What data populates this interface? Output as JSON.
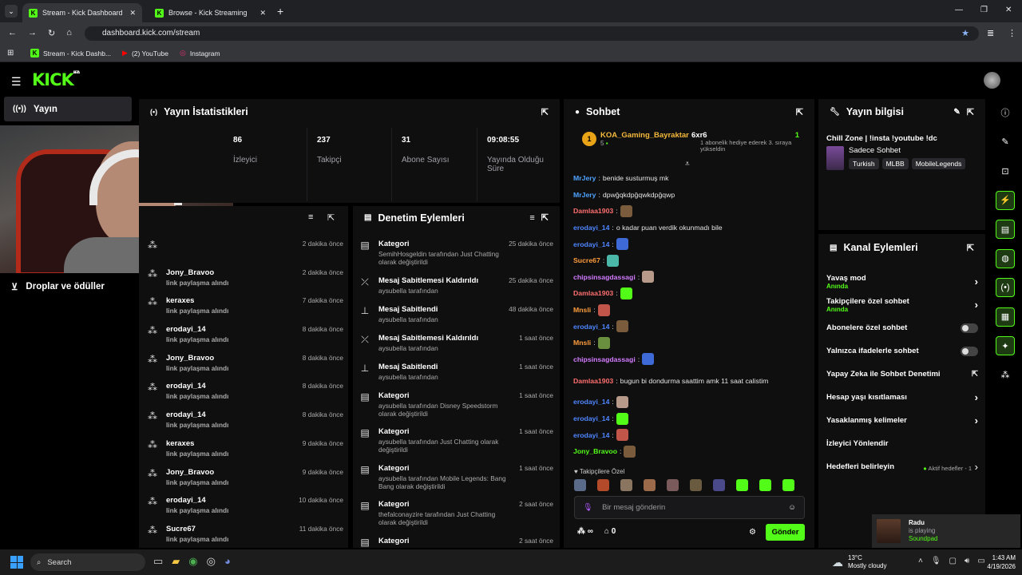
{
  "browser": {
    "tabs": [
      "Stream - Kick Dashboard",
      "Browse - Kick Streaming"
    ],
    "url": "dashboard.kick.com/stream",
    "bookmarks": [
      "Stream - Kick Dashb...",
      "(2) YouTube",
      "Instagram"
    ]
  },
  "app": {
    "logo": "KICK",
    "beta": "BETA"
  },
  "nav": {
    "stream": "Yayın",
    "drops": "Droplar ve ödüller"
  },
  "stats": {
    "title": "Yayın İstatistikleri",
    "items": [
      {
        "value": "86",
        "label": "İzleyici"
      },
      {
        "value": "237",
        "label": "Takipçi"
      },
      {
        "value": "31",
        "label": "Abone Sayısı"
      },
      {
        "value": "09:08:55",
        "label": "Yayında Olduğu Süre"
      }
    ]
  },
  "rewards": [
    {
      "user": "",
      "action": "",
      "time": "2 dakika önce"
    },
    {
      "user": "Jony_Bravoo",
      "action": "link paylaşma alındı",
      "time": "2 dakika önce"
    },
    {
      "user": "keraxes",
      "action": "link paylaşma alındı",
      "time": "7 dakika önce"
    },
    {
      "user": "erodayi_14",
      "action": "link paylaşma alındı",
      "time": "8 dakika önce"
    },
    {
      "user": "Jony_Bravoo",
      "action": "link paylaşma alındı",
      "time": "8 dakika önce"
    },
    {
      "user": "erodayi_14",
      "action": "link paylaşma alındı",
      "time": "8 dakika önce"
    },
    {
      "user": "erodayi_14",
      "action": "link paylaşma alındı",
      "time": "8 dakika önce"
    },
    {
      "user": "keraxes",
      "action": "link paylaşma alındı",
      "time": "9 dakika önce"
    },
    {
      "user": "Jony_Bravoo",
      "action": "link paylaşma alındı",
      "time": "9 dakika önce"
    },
    {
      "user": "erodayi_14",
      "action": "link paylaşma alındı",
      "time": "10 dakika önce"
    },
    {
      "user": "Sucre67",
      "action": "link paylaşma alındı",
      "time": "11 dakika önce"
    }
  ],
  "moderation": {
    "title": "Denetim Eylemleri",
    "items": [
      {
        "title": "Kategori",
        "sub": "SemihHosgeldin tarafından Just Chatting olarak değiştirildi",
        "time": "25 dakika önce",
        "icon": "category"
      },
      {
        "title": "Mesaj Sabitlemesi Kaldırıldı",
        "sub": "aysubella tarafından",
        "time": "25 dakika önce",
        "icon": "unpin"
      },
      {
        "title": "Mesaj Sabitlendi",
        "sub": "aysubella tarafından",
        "time": "48 dakika önce",
        "icon": "pin"
      },
      {
        "title": "Mesaj Sabitlemesi Kaldırıldı",
        "sub": "aysubella tarafından",
        "time": "1 saat önce",
        "icon": "unpin"
      },
      {
        "title": "Mesaj Sabitlendi",
        "sub": "aysubella tarafından",
        "time": "1 saat önce",
        "icon": "pin"
      },
      {
        "title": "Kategori",
        "sub": "aysubella tarafından Disney Speedstorm olarak değiştirildi",
        "time": "1 saat önce",
        "icon": "category"
      },
      {
        "title": "Kategori",
        "sub": "aysubella tarafından Just Chatting olarak değiştirildi",
        "time": "1 saat önce",
        "icon": "category"
      },
      {
        "title": "Kategori",
        "sub": "aysubella tarafından Mobile Legends: Bang Bang olarak değiştirildi",
        "time": "1 saat önce",
        "icon": "category"
      },
      {
        "title": "Kategori",
        "sub": "thefalconayzire tarafından Just Chatting olarak değiştirildi",
        "time": "2 saat önce",
        "icon": "category"
      },
      {
        "title": "Kategori",
        "sub": "",
        "time": "2 saat önce",
        "icon": "category"
      }
    ]
  },
  "chat": {
    "title": "Sohbet",
    "top_user": "KOA_Gaming_Bayraktar",
    "top_count": "5",
    "top_rank": "1",
    "gifter": "6xr6",
    "gifter_count": "1",
    "gifter_note": "1 abonelik hediye ederek 3. sıraya yükseldin",
    "messages": [
      {
        "user": "MrJery",
        "color": "#4fa3ff",
        "text": "benide susturmuş mk"
      },
      {
        "user": "MrJery",
        "color": "#4fa3ff",
        "text": "dpwğqkdpğqwkdpğqwp"
      },
      {
        "user": "Damlaa1903",
        "color": "#ff6f6f",
        "text": ""
      },
      {
        "user": "erodayi_14",
        "color": "#4f86ff",
        "text": "o kadar puan verdik okunmadı bile"
      },
      {
        "user": "erodayi_14",
        "color": "#4f86ff",
        "text": ""
      },
      {
        "user": "Sucre67",
        "color": "#ff9d3c",
        "text": ""
      },
      {
        "user": "chipsinsagdassagi",
        "color": "#d37cff",
        "text": ""
      },
      {
        "user": "Damlaa1903",
        "color": "#ff6f6f",
        "text": ""
      },
      {
        "user": "Mnsli",
        "color": "#ff9d3c",
        "text": ""
      },
      {
        "user": "erodayi_14",
        "color": "#4f86ff",
        "text": ""
      },
      {
        "user": "Mnsli",
        "color": "#ff9d3c",
        "text": ""
      },
      {
        "user": "chipsinsagdassagi",
        "color": "#d37cff",
        "text": ""
      },
      {
        "user": "Damlaa1903",
        "color": "#ff6f6f",
        "text": "bugun bi dondurma saattim amk 11 saat calistim"
      },
      {
        "user": "erodayi_14",
        "color": "#4f86ff",
        "text": ""
      },
      {
        "user": "erodayi_14",
        "color": "#4f86ff",
        "text": ""
      },
      {
        "user": "erodayi_14",
        "color": "#4f86ff",
        "text": ""
      },
      {
        "user": "Jony_Bravoo",
        "color": "#53fc18",
        "text": ""
      }
    ],
    "followers_only": "Takipçilere Özel",
    "placeholder": "Bir mesaj gönderin",
    "send": "Gönder",
    "points": "0"
  },
  "stream_info": {
    "title": "Yayın bilgisi",
    "stream_title": "Chill Zone | !insta !youtube !dc",
    "category": "Sadece Sohbet",
    "tags": [
      "Turkish",
      "MLBB",
      "MobileLegends"
    ]
  },
  "channel_actions": {
    "title": "Kanal Eylemleri",
    "items": [
      {
        "label": "Yavaş mod",
        "sub": "Anında",
        "type": "chevron"
      },
      {
        "label": "Takipçilere özel sohbet",
        "sub": "Anında",
        "type": "chevron"
      },
      {
        "label": "Abonelere özel sohbet",
        "sub": "",
        "type": "toggle"
      },
      {
        "label": "Yalnızca ifadelerle sohbet",
        "sub": "",
        "type": "toggle"
      },
      {
        "label": "Yapay Zeka ile Sohbet Denetimi",
        "sub": "",
        "type": "external"
      },
      {
        "label": "Hesap yaşı kısıtlaması",
        "sub": "",
        "type": "chevron"
      },
      {
        "label": "Yasaklanmış kelimeler",
        "sub": "",
        "type": "chevron"
      },
      {
        "label": "İzleyici Yönlendir",
        "sub": "",
        "type": "none"
      },
      {
        "label": "Hedefleri belirleyin",
        "sub": "",
        "type": "goal",
        "extra": "Aktif hedefler - 1"
      }
    ]
  },
  "notification": {
    "name": "Radu",
    "status": "is playing",
    "app": "Soundpad"
  },
  "taskbar": {
    "search": "Search",
    "weather": "13°C",
    "weather_desc": "Mostly cloudy",
    "time": "1:43 AM",
    "date": "4/19/2026"
  }
}
